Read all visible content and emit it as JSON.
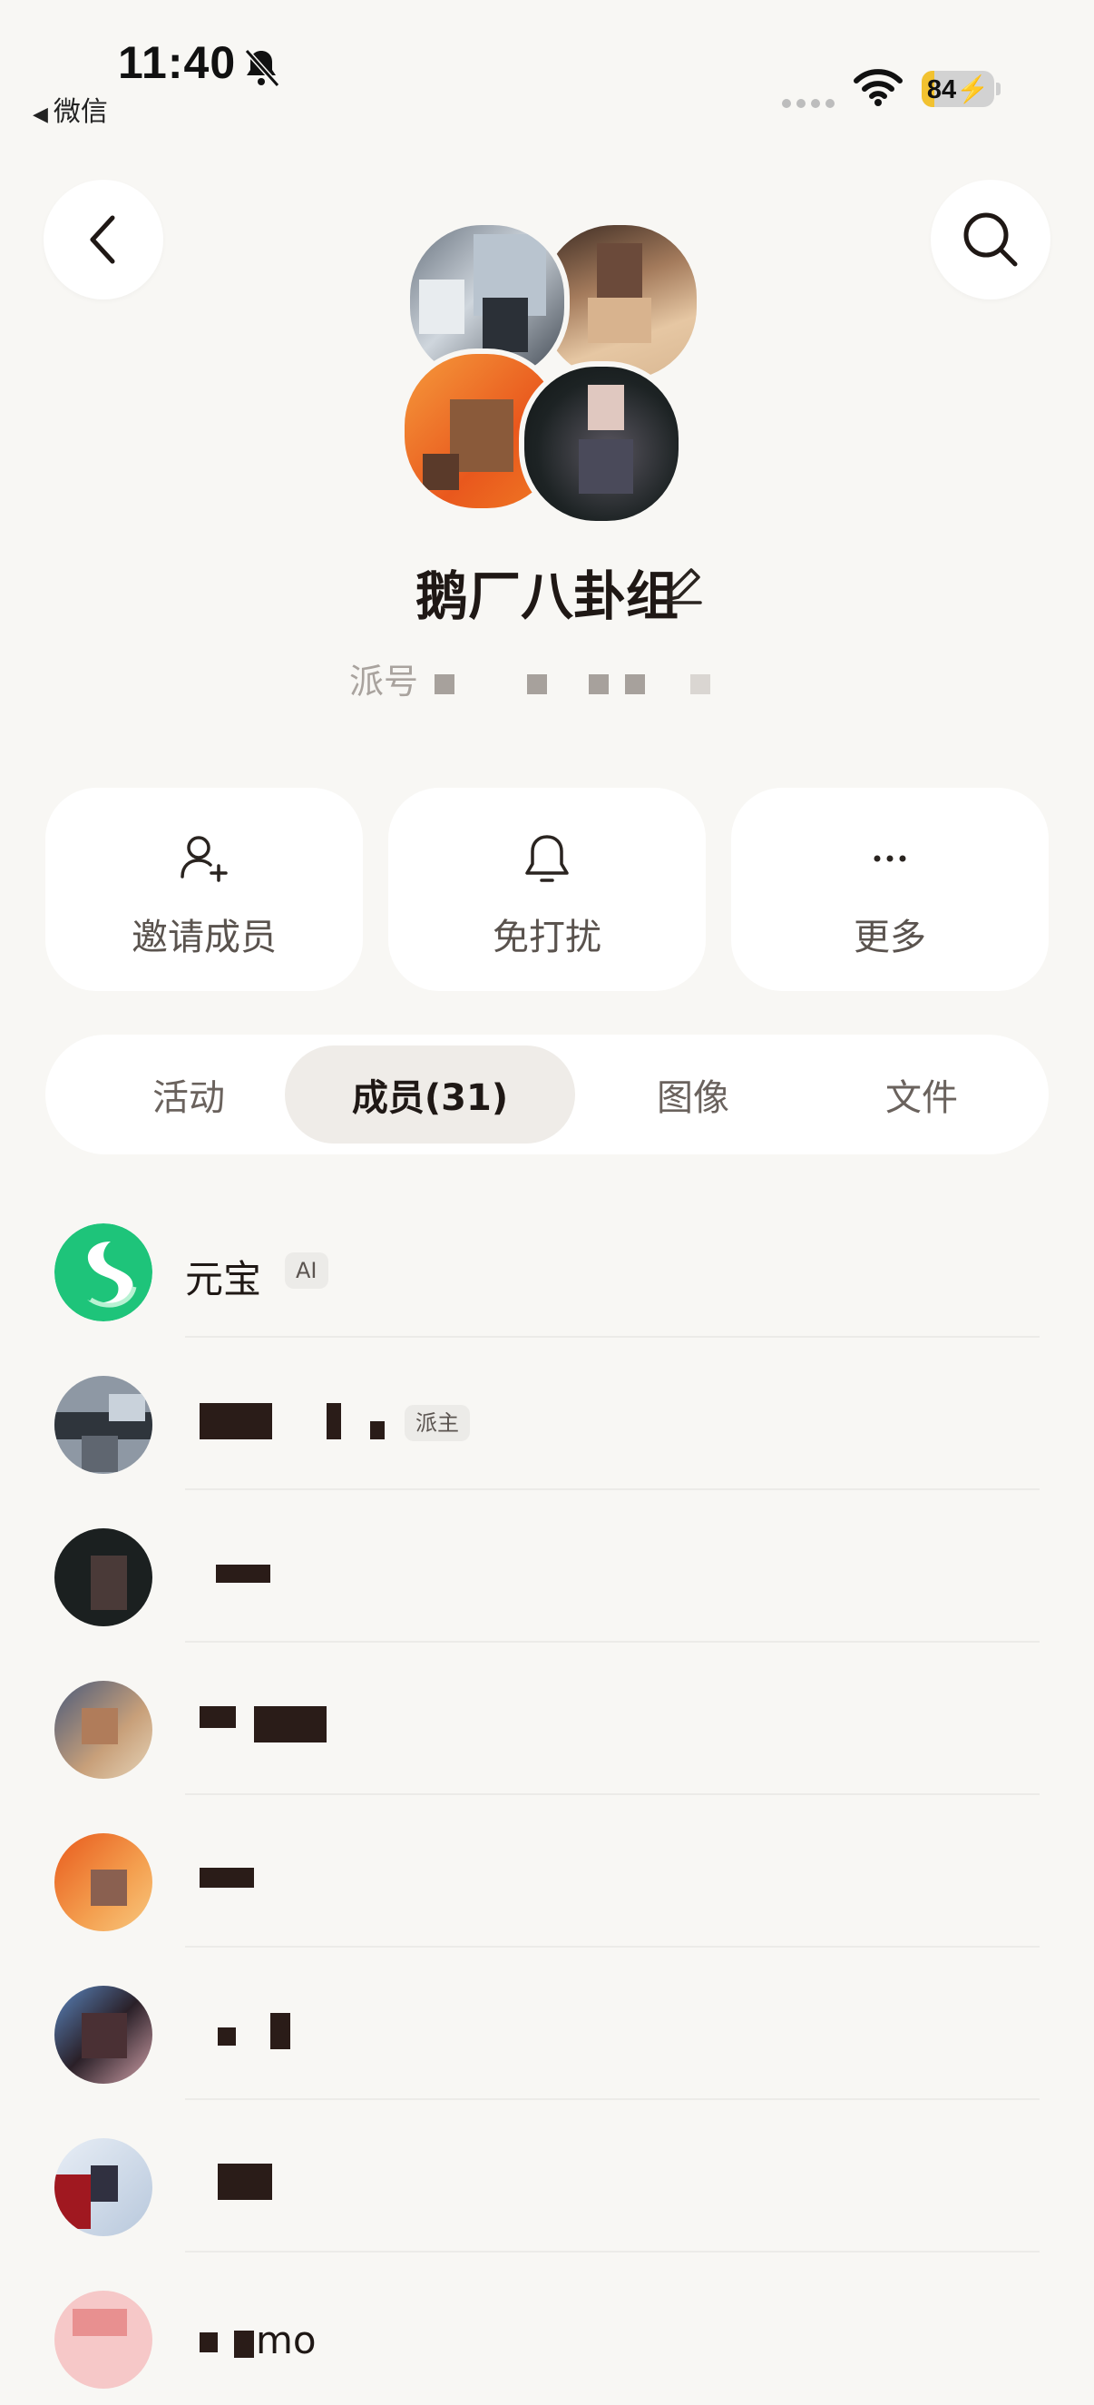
{
  "status_bar": {
    "time": "11:40",
    "back_app": "微信",
    "battery": "84"
  },
  "header": {
    "group_name": "鹅厂八卦组",
    "group_id_label": "派号"
  },
  "actions": [
    {
      "label": "邀请成员",
      "icon": "add-user-icon"
    },
    {
      "label": "免打扰",
      "icon": "bell-icon"
    },
    {
      "label": "更多",
      "icon": "more-icon"
    }
  ],
  "tabs": [
    {
      "label": "活动",
      "active": false
    },
    {
      "label": "成员(31)",
      "active": true
    },
    {
      "label": "图像",
      "active": false
    },
    {
      "label": "文件",
      "active": false
    }
  ],
  "members": [
    {
      "name": "元宝",
      "badge": "AI"
    },
    {
      "name": "",
      "badge": "派主"
    },
    {
      "name": "",
      "badge": ""
    },
    {
      "name": "",
      "badge": ""
    },
    {
      "name": "",
      "badge": ""
    },
    {
      "name": "",
      "badge": ""
    },
    {
      "name": "",
      "badge": ""
    },
    {
      "name": "mo",
      "badge": ""
    }
  ],
  "colors": {
    "background": "#f8f7f4",
    "card": "#ffffff",
    "active_tab": "#efece8",
    "yuanbao_green": "#1ec47a"
  }
}
